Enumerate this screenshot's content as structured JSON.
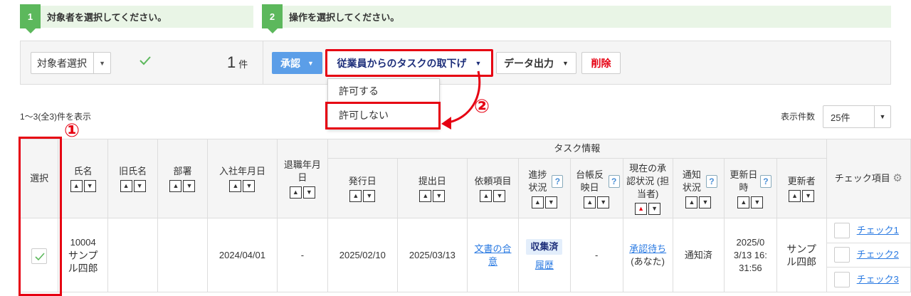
{
  "steps": [
    {
      "num": "1",
      "text": "対象者を選択してください。"
    },
    {
      "num": "2",
      "text": "操作を選択してください。"
    }
  ],
  "toolbar": {
    "target_select": "対象者選択",
    "count_value": "1",
    "count_unit": "件",
    "approve_label": "承認",
    "withdraw_label": "従業員からのタスクの取下げ",
    "export_label": "データ出力",
    "delete_label": "削除"
  },
  "dropdown": {
    "items": [
      "許可する",
      "許可しない"
    ]
  },
  "annotations": {
    "marker1": "①",
    "marker2": "②"
  },
  "list": {
    "range_text": "1〜3(全3)件を表示",
    "per_page_label": "表示件数",
    "per_page_value": "25件"
  },
  "table": {
    "headers": {
      "select": "選択",
      "name": "氏名",
      "old_name": "旧氏名",
      "dept": "部署",
      "join_date": "入社年月日",
      "leave_date": "退職年月日",
      "task_info": "タスク情報",
      "issue_date": "発行日",
      "submit_date": "提出日",
      "request_item": "依頼項目",
      "progress": "進捗状況",
      "ledger": "台帳反映日",
      "approval": "現在の承認状況 (担当者)",
      "notify": "通知状況",
      "updated_at": "更新日時",
      "updater": "更新者",
      "check_items": "チェック項目"
    },
    "row": {
      "id": "10004",
      "name": "サンプル四郎",
      "join_date": "2024/04/01",
      "leave_date": "-",
      "issue_date": "2025/02/10",
      "submit_date": "2025/03/13",
      "request_item": "文書の合意",
      "progress_badge": "収集済",
      "progress_link": "履歴",
      "ledger": "-",
      "approval_link": "承認待ち",
      "approval_sub": "(あなた)",
      "notify": "通知済",
      "updated_at": "2025/03/13 16:31:56",
      "updater": "サンプル四郎",
      "checks": [
        "チェック1",
        "チェック2",
        "チェック3"
      ]
    }
  },
  "colors": {
    "accent_green": "#5cb85c",
    "primary_blue": "#5b9ee8",
    "danger_red": "#e60012"
  }
}
